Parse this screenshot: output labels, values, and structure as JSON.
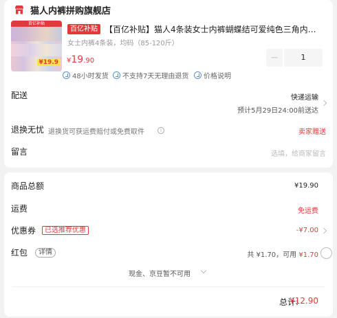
{
  "shop": {
    "name": "猫人内裤拼购旗舰店",
    "icon": "store-icon"
  },
  "product": {
    "tag": "百亿补贴",
    "title": "【百亿补贴】猫人4条装女士内裤蝴蝶结可爱纯色三角内裤 …",
    "spec": "女士内裤4条装，均码（85-120斤）",
    "price_symbol": "¥",
    "price_int": "19",
    "price_dec": ".90",
    "image_badge": "百亿补贴",
    "image_price": "¥19.9",
    "quantity": "1",
    "minus": "−"
  },
  "services": [
    {
      "label": "48小时发货",
      "icon": "check-circle-icon"
    },
    {
      "label": "不支持7天无理由退货",
      "icon": "no-return-icon"
    },
    {
      "label": "价格说明",
      "icon": "info-icon"
    }
  ],
  "delivery": {
    "label": "配送",
    "method": "快递运输",
    "eta": "预计5月29日24:00前送达"
  },
  "returns": {
    "label": "退换无忧",
    "desc": "退换货可获运费赔付或免费取件",
    "value": "卖家赠送"
  },
  "message": {
    "label": "留言",
    "placeholder": "选填，给商家留言"
  },
  "summary": {
    "total_goods_label": "商品总额",
    "total_goods_value": "¥19.90",
    "shipping_label": "运费",
    "shipping_value": "免运费",
    "coupon_label": "优惠券",
    "coupon_tag": "已选推荐优惠",
    "coupon_value": "-¥7.00",
    "redpacket_label": "红包",
    "redpacket_detail": "详情",
    "redpacket_total": "共 ¥1.70，可用",
    "redpacket_available": "¥1.70",
    "cash_note": "现金、京豆暂不可用",
    "grand_total_label": "总计:",
    "grand_total_value": "¥12.90"
  },
  "colors": {
    "accent": "#e4393c",
    "background": "#f2f2f2",
    "card": "#ffffff",
    "link_blue": "#5b8fd6"
  }
}
